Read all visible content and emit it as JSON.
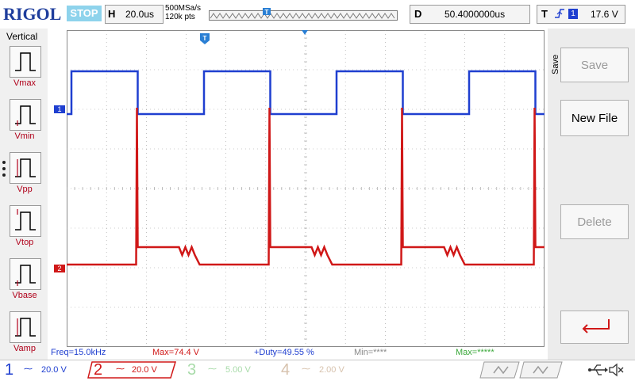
{
  "header": {
    "logo": "RIGOL",
    "run_status": "STOP",
    "timebase_label": "H",
    "timebase_value": "20.0us",
    "sample_rate": "500MSa/s",
    "memory_depth": "120k pts",
    "delay_label": "D",
    "delay_value": "50.4000000us",
    "trigger_label": "T",
    "trigger_source": "1",
    "trigger_level": "17.6 V"
  },
  "left_panel": {
    "title": "Vertical",
    "items": [
      {
        "label": "Vmax"
      },
      {
        "label": "Vmin"
      },
      {
        "label": "Vpp"
      },
      {
        "label": "Vtop"
      },
      {
        "label": "Vbase"
      },
      {
        "label": "Vamp"
      }
    ]
  },
  "right_panel": {
    "title": "Save",
    "save_label": "Save",
    "new_file_label": "New File",
    "delete_label": "Delete"
  },
  "markers": {
    "ch1": "1",
    "ch2": "2",
    "trigger": "T"
  },
  "measurements": {
    "freq": "Freq=15.0kHz",
    "max": "Max=74.4 V",
    "duty": "+Duty=49.55 %",
    "min": "Min=****",
    "max2": "Max=*****"
  },
  "channels": [
    {
      "num": "1",
      "value": "20.0 V",
      "color": "#1f3fd0"
    },
    {
      "num": "2",
      "value": "20.0 V",
      "color": "#d01818"
    },
    {
      "num": "3",
      "value": "5.00 V",
      "color": "#6cc070"
    },
    {
      "num": "4",
      "value": "2.00 V",
      "color": "#b8906a"
    }
  ],
  "colors": {
    "ch1": "#1f3fd0",
    "ch2": "#d01818",
    "grid": "#9a9a9a",
    "measure_label": "#b0001a"
  }
}
